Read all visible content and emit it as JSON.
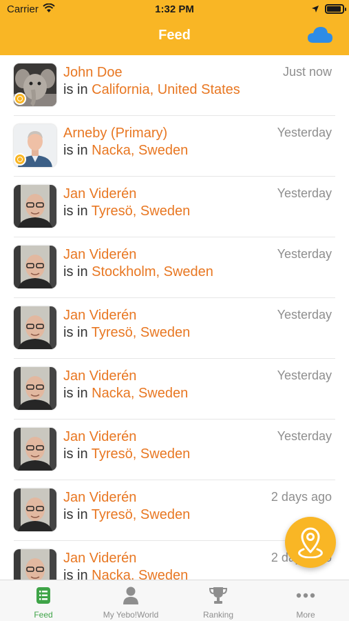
{
  "status_bar": {
    "carrier": "Carrier",
    "time": "1:32 PM"
  },
  "nav": {
    "title": "Feed",
    "action_icon": "cloud-icon"
  },
  "colors": {
    "accent": "#F9B625",
    "link": "#E87722",
    "active_tab": "#3FA448"
  },
  "feed": {
    "prefix": "is in",
    "items": [
      {
        "name": "John Doe",
        "place": "California, United States",
        "when": "Just now"
      },
      {
        "name": "Arneby (Primary)",
        "place": "Nacka, Sweden",
        "when": "Yesterday"
      },
      {
        "name": "Jan Viderén",
        "place": "Tyresö, Sweden",
        "when": "Yesterday"
      },
      {
        "name": "Jan Viderén",
        "place": "Stockholm, Sweden",
        "when": "Yesterday"
      },
      {
        "name": "Jan Viderén",
        "place": "Tyresö, Sweden",
        "when": "Yesterday"
      },
      {
        "name": "Jan Viderén",
        "place": "Nacka, Sweden",
        "when": "Yesterday"
      },
      {
        "name": "Jan Viderén",
        "place": "Tyresö, Sweden",
        "when": "Yesterday"
      },
      {
        "name": "Jan Viderén",
        "place": "Tyresö, Sweden",
        "when": "2 days ago"
      },
      {
        "name": "Jan Viderén",
        "place": "Nacka, Sweden",
        "when": "2 days ago"
      }
    ]
  },
  "fab": {
    "icon": "location-pin-icon"
  },
  "tabs": [
    {
      "label": "Feed",
      "icon": "feed-icon"
    },
    {
      "label": "My Yebo!World",
      "icon": "person-icon"
    },
    {
      "label": "Ranking",
      "icon": "trophy-icon"
    },
    {
      "label": "More",
      "icon": "more-icon"
    }
  ]
}
